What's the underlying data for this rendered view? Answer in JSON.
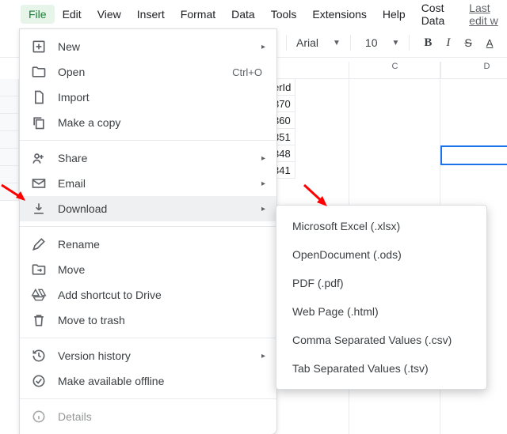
{
  "menubar": {
    "items": [
      "File",
      "Edit",
      "View",
      "Insert",
      "Format",
      "Data",
      "Tools",
      "Extensions",
      "Help",
      "Cost Data"
    ],
    "last_edit": "Last edit w"
  },
  "toolbar": {
    "font": "Arial",
    "size": "10",
    "bold": "B",
    "italic": "I",
    "strike": "S",
    "textcolor": "A"
  },
  "columns": [
    "C",
    "D"
  ],
  "data_header": "erId",
  "data_values": [
    "370",
    "360",
    "351",
    "348",
    "341"
  ],
  "file_menu": {
    "new": {
      "label": "New"
    },
    "open": {
      "label": "Open",
      "shortcut": "Ctrl+O"
    },
    "import": {
      "label": "Import"
    },
    "copy": {
      "label": "Make a copy"
    },
    "share": {
      "label": "Share"
    },
    "email": {
      "label": "Email"
    },
    "download": {
      "label": "Download"
    },
    "rename": {
      "label": "Rename"
    },
    "move": {
      "label": "Move"
    },
    "shortcut": {
      "label": "Add shortcut to Drive"
    },
    "trash": {
      "label": "Move to trash"
    },
    "version": {
      "label": "Version history"
    },
    "offline": {
      "label": "Make available offline"
    },
    "details": {
      "label": "Details"
    }
  },
  "download_menu": {
    "xlsx": "Microsoft Excel (.xlsx)",
    "ods": "OpenDocument (.ods)",
    "pdf": "PDF (.pdf)",
    "html": "Web Page (.html)",
    "csv": "Comma Separated Values (.csv)",
    "tsv": "Tab Separated Values (.tsv)"
  }
}
